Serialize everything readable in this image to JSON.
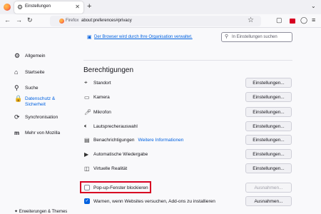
{
  "tab": {
    "title": "Einstellungen"
  },
  "urlbar": {
    "identity": "Firefox",
    "url": "about:preferences#privacy"
  },
  "banner": {
    "text": "Der Browser wird durch Ihre Organisation verwaltet."
  },
  "search": {
    "placeholder": "In Einstellungen suchen"
  },
  "sidebar": {
    "items": [
      {
        "label": "Allgemein"
      },
      {
        "label": "Startseite"
      },
      {
        "label": "Suche"
      },
      {
        "label_line1": "Datenschutz &",
        "label_line2": "Sicherheit"
      },
      {
        "label": "Synchronisation"
      },
      {
        "label": "Mehr von Mozilla"
      }
    ],
    "footer": "Erweiterungen & Themes"
  },
  "permissions": {
    "title": "Berechtigungen",
    "button_label": "Einstellungen...",
    "rows": [
      {
        "label": "Standort"
      },
      {
        "label": "Kamera"
      },
      {
        "label": "Mikrofon"
      },
      {
        "label": "Lautsprecherauswahl"
      },
      {
        "label": "Benachrichtigungen",
        "link": "Weitere Informationen"
      },
      {
        "label": "Automatische Wiedergabe"
      },
      {
        "label": "Virtuelle Realität"
      }
    ]
  },
  "popups": {
    "label": "Pop-up-Fenster blockieren",
    "checked": false,
    "button": "Ausnahmen..."
  },
  "addons": {
    "label": "Warnen, wenn Websites versuchen, Add-ons zu installieren",
    "checked": true,
    "button": "Ausnahmen..."
  },
  "colors": {
    "accent": "#0061e0",
    "highlight": "#d70022"
  }
}
